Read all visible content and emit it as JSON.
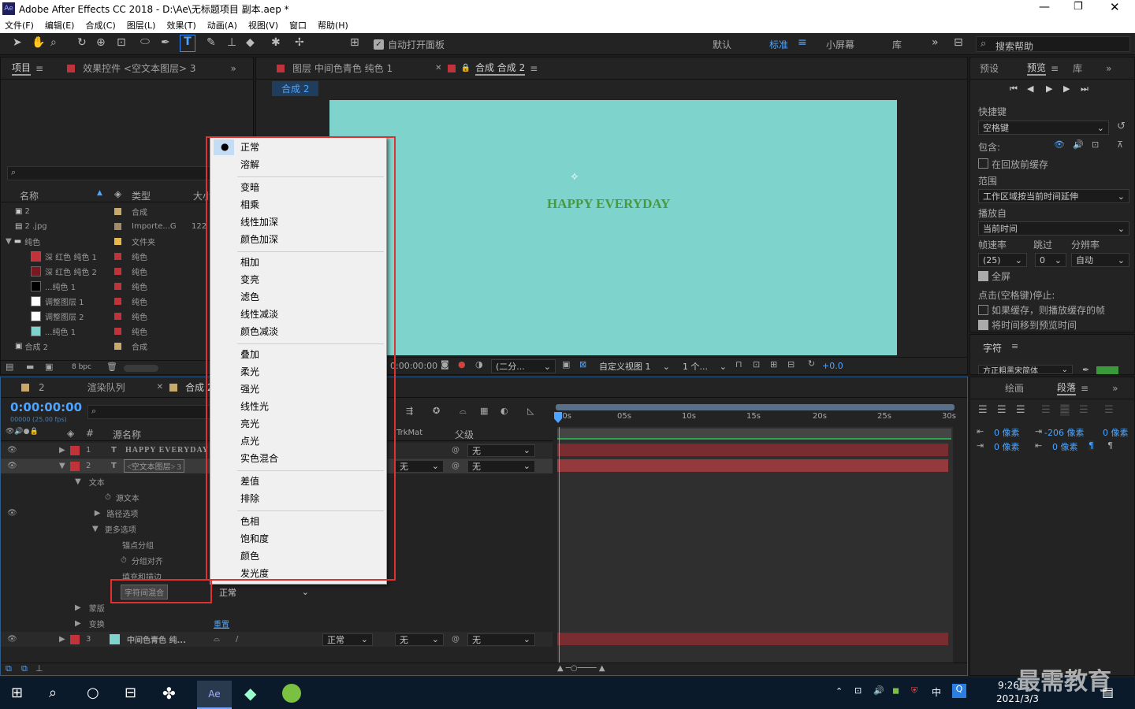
{
  "window": {
    "title": "Adobe After Effects CC 2018 - D:\\Ae\\无标题项目 副本.aep *",
    "app_icon": "Ae"
  },
  "menubar": [
    "文件(F)",
    "编辑(E)",
    "合成(C)",
    "图层(L)",
    "效果(T)",
    "动画(A)",
    "视图(V)",
    "窗口",
    "帮助(H)"
  ],
  "toolbar": {
    "auto_open": "自动打开面板",
    "workspaces": [
      "默认",
      "标准",
      "小屏幕",
      "库"
    ],
    "search_help": "搜索帮助"
  },
  "project": {
    "tab": "项目",
    "effects_tab": "效果控件 <空文本图层> 3",
    "cols": {
      "name": "名称",
      "type": "类型",
      "size": "大小"
    },
    "items": [
      {
        "name": "2",
        "type": "合成",
        "size": ""
      },
      {
        "name": "2 .jpg",
        "type": "Importe...G",
        "size": "122"
      },
      {
        "name": "纯色",
        "type": "文件夹",
        "size": ""
      },
      {
        "name": "深 红色 纯色 1",
        "type": "纯色",
        "size": "",
        "color": "#c0333a"
      },
      {
        "name": "深 红色 纯色 2",
        "type": "纯色",
        "size": "",
        "color": "#7a1a20"
      },
      {
        "name": "...纯色 1",
        "type": "纯色",
        "size": "",
        "color": "#000000"
      },
      {
        "name": "调整图层 1",
        "type": "纯色",
        "size": "",
        "color": "#ffffff"
      },
      {
        "name": "调整图层 2",
        "type": "纯色",
        "size": "",
        "color": "#ffffff"
      },
      {
        "name": "...纯色 1",
        "type": "纯色",
        "size": "",
        "color": "#7ed3cd"
      },
      {
        "name": "合成 2",
        "type": "合成",
        "size": ""
      }
    ],
    "bpc": "8 bpc"
  },
  "viewer": {
    "tab1": "图层 中间色青色 纯色 1",
    "tab2": "合成 合成 2",
    "crumb": "合成 2",
    "text": "HAPPY EVERYDAY",
    "bg": "#7ed3cd",
    "timecode": "0:00:00:00",
    "res": "(二分...",
    "view": "自定义视图 1",
    "views": "1 个...",
    "exposure": "+0.0"
  },
  "preview": {
    "tab1": "预设",
    "tab2": "预览",
    "tab3": "库",
    "shortcut_label": "快捷键",
    "shortcut": "空格键",
    "include": "包含:",
    "cache": "在回放前缓存",
    "range_label": "范围",
    "range": "工作区域按当前时间延伸",
    "play_from_label": "播放自",
    "play_from": "当前时间",
    "fps_label": "帧速率",
    "skip_label": "跳过",
    "res_label": "分辨率",
    "fps": "(25)",
    "skip": "0",
    "res": "自动",
    "fullscreen": "全屏",
    "stop_label": "点击(空格键)停止:",
    "cache_opt": "如果缓存，则播放缓存的帧",
    "move_time": "将时间移到预览时间",
    "char_tab": "字符",
    "font": "方正粗黑宋简体"
  },
  "paragraph": {
    "tab1": "绘画",
    "tab2": "段落",
    "v1": "0 像素",
    "v2": "-206 像素",
    "v3": "0 像素",
    "v4": "0 像素",
    "v5": "0 像素"
  },
  "timeline": {
    "tab_comp": "2",
    "render_tab": "渲染队列",
    "comp_tab": "合成 2",
    "timecode": "0:00:00:00",
    "fps": "00000 (25.00 fps)",
    "col_name": "源名称",
    "col_trk": "TrkMat",
    "col_parent": "父级",
    "ruler": [
      "00s",
      "05s",
      "10s",
      "15s",
      "20s",
      "25s",
      "30s"
    ],
    "layers": [
      {
        "num": "1",
        "name": "HAPPY EVERYDAY",
        "parent": "无"
      },
      {
        "num": "2",
        "name": "<空文本图层> 3",
        "trk": "无",
        "parent": "无"
      },
      {
        "num": "3",
        "name": "中间色青色 纯...",
        "mode": "正常",
        "trk": "无",
        "parent": "无"
      }
    ],
    "props": [
      "文本",
      "源文本",
      "路径选项",
      "更多选项",
      "锚点分组",
      "分组对齐",
      "填充和描边",
      "字符间混合",
      "蒙版",
      "变换"
    ],
    "blend_value": "正常",
    "reset": "重置"
  },
  "blend_menu": [
    "正常",
    "溶解",
    "变暗",
    "相乘",
    "线性加深",
    "颜色加深",
    "相加",
    "变亮",
    "滤色",
    "线性减淡",
    "颜色减淡",
    "叠加",
    "柔光",
    "强光",
    "线性光",
    "亮光",
    "点光",
    "实色混合",
    "差值",
    "排除",
    "色相",
    "饱和度",
    "颜色",
    "发光度"
  ],
  "taskbar": {
    "time": "9:26",
    "date": "2021/3/3",
    "ime": "中",
    "watermark": "最需教育"
  }
}
